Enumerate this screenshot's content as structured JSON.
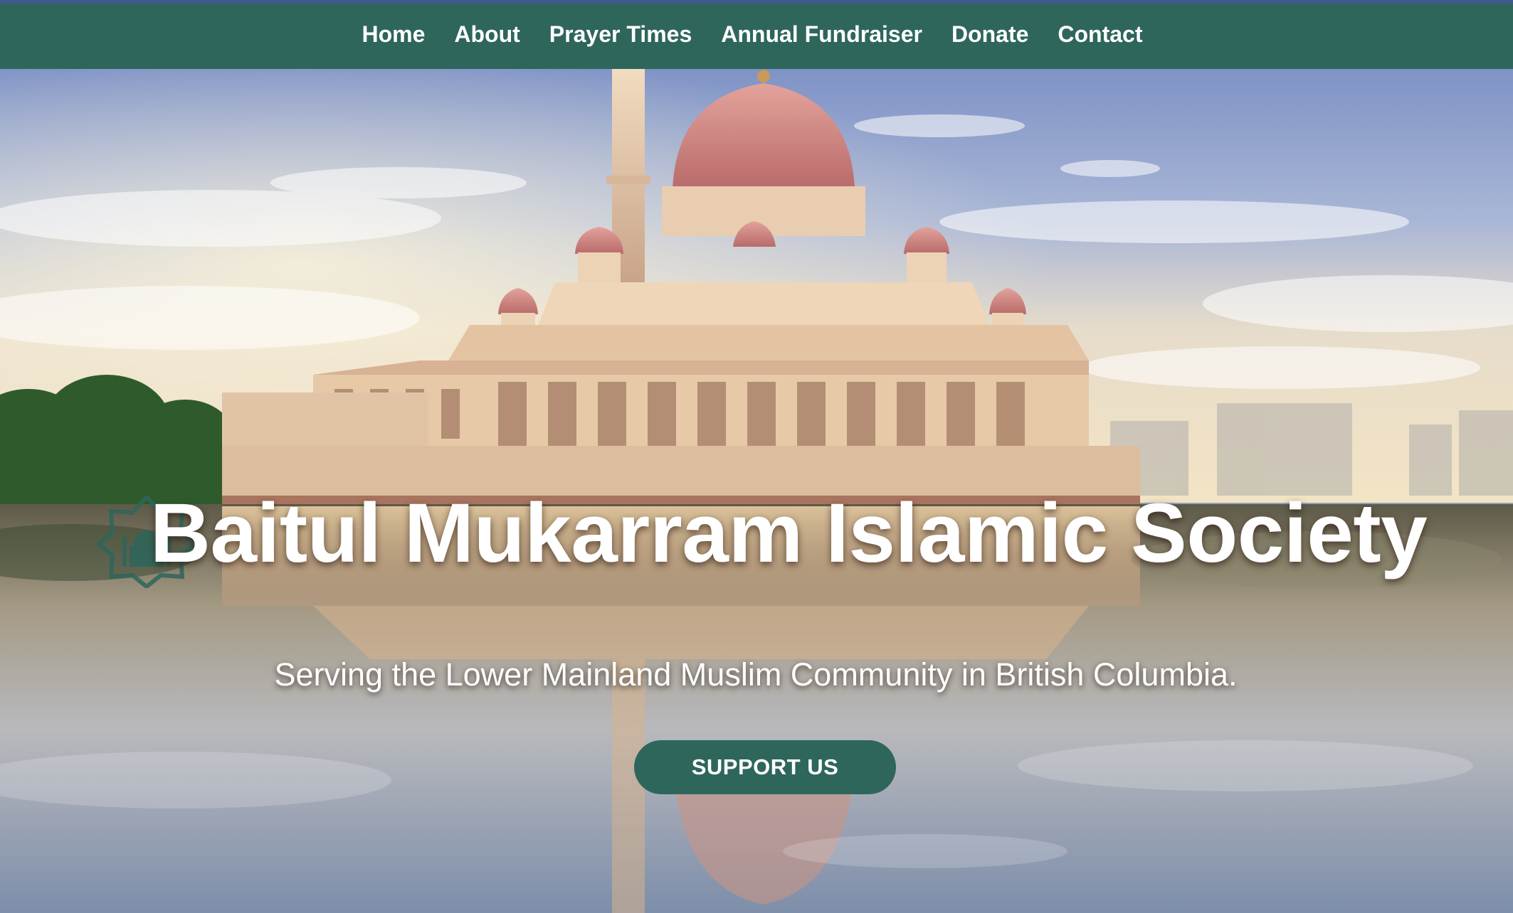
{
  "nav": {
    "items": [
      {
        "label": "Home"
      },
      {
        "label": "About"
      },
      {
        "label": "Prayer Times"
      },
      {
        "label": "Annual Fundraiser"
      },
      {
        "label": "Donate"
      },
      {
        "label": "Contact"
      }
    ]
  },
  "hero": {
    "title": "Baitul Mukarram Islamic Society",
    "subtitle": "Serving the Lower Mainland Muslim Community in British Columbia.",
    "cta_label": "SUPPORT US"
  },
  "logo": {
    "icon": "mosque-star-icon"
  },
  "colors": {
    "nav_bg": "#2e665c",
    "top_line": "#3f5a86",
    "button_bg": "#2e665c",
    "text": "#ffffff"
  }
}
